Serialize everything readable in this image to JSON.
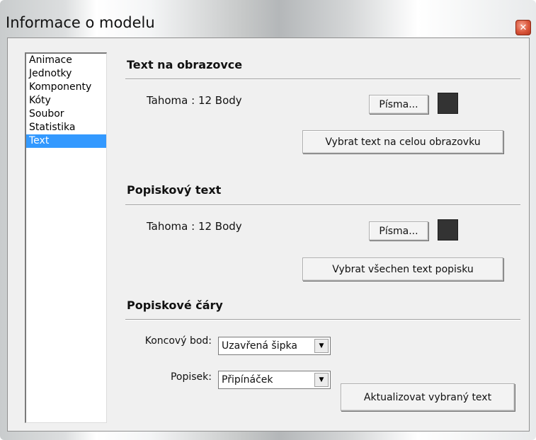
{
  "window": {
    "title": "Informace o modelu"
  },
  "sidebar": {
    "items": [
      "Animace",
      "Jednotky",
      "Komponenty",
      "Kóty",
      "Soubor",
      "Statistika",
      "Text"
    ],
    "selected_index": 6
  },
  "screen_text": {
    "heading": "Text na obrazovce",
    "font": "Tahoma : 12 Body",
    "fonts_button": "Písma...",
    "select_button": "Vybrat text na celou obrazovku",
    "color": "#333333"
  },
  "label_text": {
    "heading": "Popiskový text",
    "font": "Tahoma : 12 Body",
    "fonts_button": "Písma...",
    "select_button": "Vybrat všechen text popisku",
    "color": "#333333"
  },
  "leader_lines": {
    "heading": "Popiskové čáry",
    "endpoint_label": "Koncový bod:",
    "endpoint_value": "Uzavřená šipka",
    "label_label": "Popisek:",
    "label_value": "Připínáček",
    "update_button": "Aktualizovat vybraný text"
  },
  "colors": {
    "selection": "#3399ff",
    "dialog_bg": "#f0f0f0"
  }
}
